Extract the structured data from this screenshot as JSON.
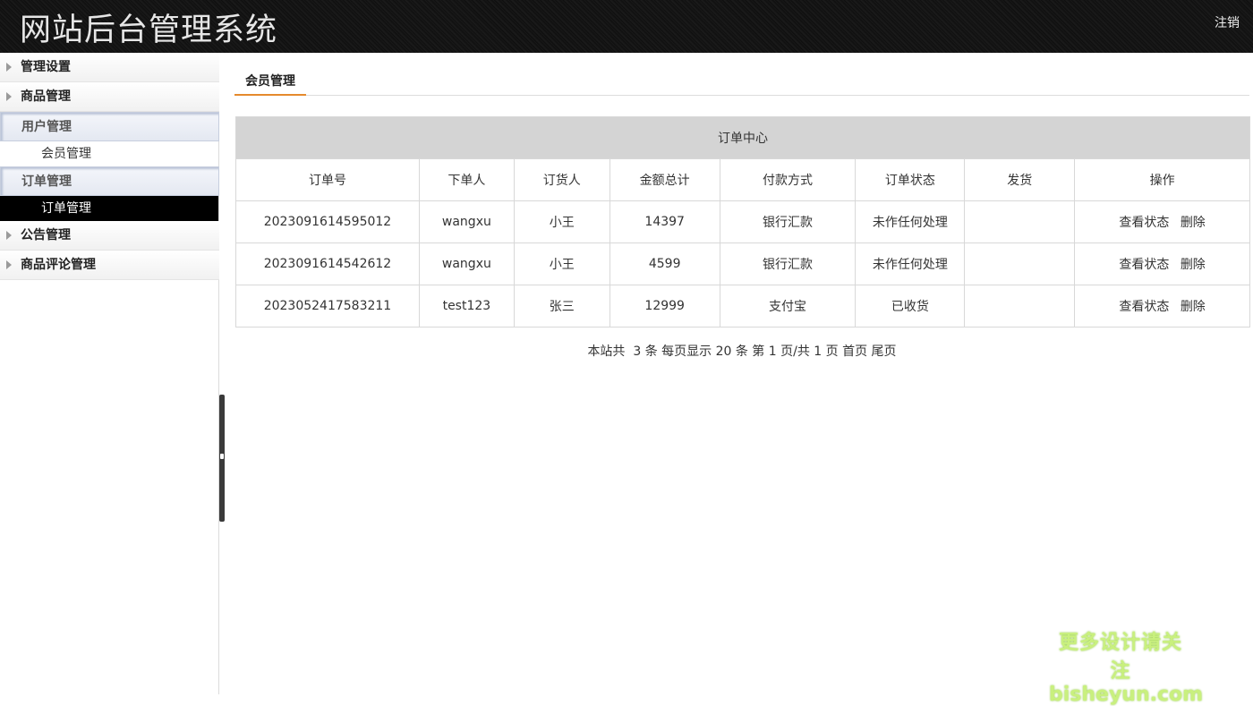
{
  "header": {
    "title": "网站后台管理系统",
    "logout": "注销"
  },
  "sidebar": {
    "items": [
      {
        "label": "管理设置"
      },
      {
        "label": "商品管理"
      },
      {
        "label": "用户管理",
        "sub": "会员管理"
      },
      {
        "label": "订单管理",
        "sub": "订单管理"
      },
      {
        "label": "公告管理"
      },
      {
        "label": "商品评论管理"
      }
    ]
  },
  "main": {
    "tab": "会员管理",
    "table": {
      "caption": "订单中心",
      "columns": [
        "订单号",
        "下单人",
        "订货人",
        "金额总计",
        "付款方式",
        "订单状态",
        "发货",
        "操作"
      ],
      "rows": [
        {
          "order_no": "2023091614595012",
          "buyer": "wangxu",
          "receiver": "小王",
          "total": "14397",
          "payment": "银行汇款",
          "status": "未作任何处理",
          "shipping": "",
          "view": "查看状态",
          "delete": "删除"
        },
        {
          "order_no": "2023091614542612",
          "buyer": "wangxu",
          "receiver": "小王",
          "total": "4599",
          "payment": "银行汇款",
          "status": "未作任何处理",
          "shipping": "",
          "view": "查看状态",
          "delete": "删除"
        },
        {
          "order_no": "2023052417583211",
          "buyer": "test123",
          "receiver": "张三",
          "total": "12999",
          "payment": "支付宝",
          "status": "已收货",
          "shipping": "",
          "view": "查看状态",
          "delete": "删除"
        }
      ]
    },
    "pager": "本站共  3 条 每页显示 20 条 第 1 页/共 1 页 首页 尾页"
  },
  "watermark": {
    "line1": "更多设计请关注",
    "line2": "bisheyun.com"
  }
}
